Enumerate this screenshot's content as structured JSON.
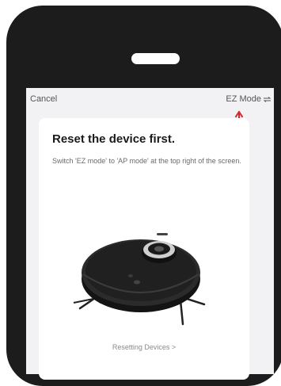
{
  "nav": {
    "cancel_label": "Cancel",
    "mode_label": "EZ Mode",
    "mode_icon": "swap-arrows-icon"
  },
  "card": {
    "title": "Reset the device first.",
    "description": "Switch 'EZ mode' to 'AP mode' at the top right of the screen.",
    "link_label": "Resetting Devices >"
  },
  "annotation": {
    "arrow_color": "#d9262c"
  },
  "device": {
    "image": "robot-vacuum"
  }
}
